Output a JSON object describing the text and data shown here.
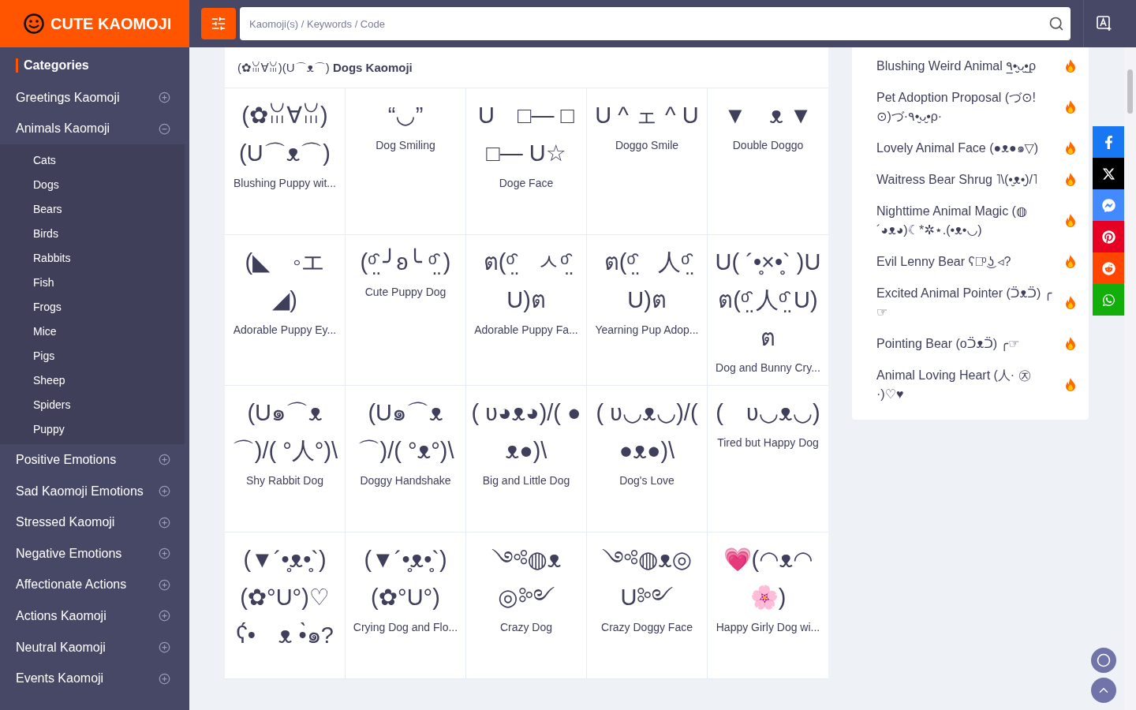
{
  "header": {
    "logo": "CUTE KAOMOJI",
    "search_placeholder": "Kaomoji(s) / Keywords / Code"
  },
  "sidebar": {
    "title": "Categories",
    "categories": [
      {
        "label": "Greetings Kaomoji",
        "expanded": false
      },
      {
        "label": "Animals Kaomoji",
        "expanded": true,
        "children": [
          {
            "label": "Cats"
          },
          {
            "label": "Dogs"
          },
          {
            "label": "Bears"
          },
          {
            "label": "Birds"
          },
          {
            "label": "Rabbits"
          },
          {
            "label": "Fish"
          },
          {
            "label": "Frogs"
          },
          {
            "label": "Mice"
          },
          {
            "label": "Pigs"
          },
          {
            "label": "Sheep"
          },
          {
            "label": "Spiders"
          },
          {
            "label": "Puppy"
          }
        ]
      },
      {
        "label": "Positive Emotions",
        "expanded": false
      },
      {
        "label": "Sad Kaomoji Emotions",
        "expanded": false
      },
      {
        "label": "Stressed Kaomoji",
        "expanded": false
      },
      {
        "label": "Negative Emotions",
        "expanded": false
      },
      {
        "label": "Affectionate Actions",
        "expanded": false
      },
      {
        "label": "Actions Kaomoji",
        "expanded": false
      },
      {
        "label": "Neutral Kaomoji",
        "expanded": false
      },
      {
        "label": "Events Kaomoji",
        "expanded": false
      }
    ]
  },
  "section": {
    "title": "(✿ꈍ∀ꈍ)(U⌒ᴥ⌒) **Dogs Kaomoji**"
  },
  "kaomoji": [
    {
      "kaomoji": "(✿ꈍ∀ꈍ)(U⌒ᴥ⌒)",
      "name": "Blushing Puppy wit..."
    },
    {
      "kaomoji": "“◡”",
      "name": "Dog Smiling"
    },
    {
      "kaomoji": "U　□— □　□— U☆",
      "name": "Doge Face"
    },
    {
      "kaomoji": "U ^ ェ ^ U",
      "name": "Doggo Smile"
    },
    {
      "kaomoji": "▼　ᴥ ▼",
      "name": "Double Doggo"
    },
    {
      "kaomoji": "(◣　◦エ ◢)",
      "name": "Adorable Puppy Ey..."
    },
    {
      "kaomoji": "(ᵒ̤̑ ╯ʚ╰ ᵒ̤̑ )",
      "name": "Cute Puppy Dog"
    },
    {
      "kaomoji": "ต(ᵒ̤̑　ㅅᵒ̤̑ U)ต",
      "name": "Adorable Puppy Fa..."
    },
    {
      "kaomoji": "ต(ᵒ̤̑　人ᵒ̤̑ U)ต",
      "name": "Yearning Pup Adop..."
    },
    {
      "kaomoji": "U( ´•̥×•̥` )Uต(ᵒ̤̑ 人ᵒ̤̑ U)ต",
      "name": "Dog and Bunny Cry..."
    },
    {
      "kaomoji": "(U๑⌒ᴥ⌒)/( °人°)\\",
      "name": "Shy Rabbit Dog"
    },
    {
      "kaomoji": "(U๑⌒ᴥ⌒)/( °ᴥ°)\\",
      "name": "Doggy Handshake"
    },
    {
      "kaomoji": "( ʋ◕ᴥ◕)/( ●ᴥ●)\\",
      "name": "Big and Little Dog"
    },
    {
      "kaomoji": "( ʋ◡ᴥ◡)/( ●ᴥ●)\\",
      "name": "Dog's Love"
    },
    {
      "kaomoji": "(　ʋ◡ᴥ◡)",
      "name": "Tired but Happy Dog"
    },
    {
      "kaomoji": "(▼´•̥ᴥ•̥`)(✿°U°)♡ ʕ́•　ᴥ •̀๑?"
    },
    {
      "kaomoji": "(▼´•̥ᴥ•̥`)(✿°U°)",
      "name": "Crying Dog and Flo..."
    },
    {
      "kaomoji": "༺◍ᴥ◎༻",
      "name": "Crazy Dog"
    },
    {
      "kaomoji": "༺◍ᴥ◎U༻",
      "name": "Crazy Doggy Face"
    },
    {
      "kaomoji": "💗(◠ᴥ◠ 🌸)",
      "name": "Happy Girly Dog wi..."
    }
  ],
  "trending": [
    {
      "text": "Blushing Weird Animal ٩̲•ּ̮̮ᴗ̮•̲ρ"
    },
    {
      "text": "Pet Adoption Proposal (づ⊙! ⊙)づ·٩•̮ᴗ̮•ρ·"
    },
    {
      "text": "Lovely Animal Face (●ᴥ●๑▽)"
    },
    {
      "text": "Waitress Bear Shrug ˥\\(•̮ᴥ•̮)/˥"
    },
    {
      "text": "Nighttime Animal Magic (◍ ´◕ᴥ◕)☾*✲⋆.(•ᴥ•◡)"
    },
    {
      "text": "Evil Lenny Bear ʕ▹ͦ ͜ʖ ◃?"
    },
    {
      "text": "Excited Animal Pointer (ᑒᴥᑒ) ╭☞"
    },
    {
      "text": "Pointing Bear (oᑒᴥᑒ) ╭☞"
    },
    {
      "text": "Animal Loving Heart (人· ㉨·)♡♥"
    }
  ],
  "share": [
    {
      "kind": "facebook",
      "color": "#1877f2"
    },
    {
      "kind": "x",
      "color": "#000000"
    },
    {
      "kind": "messenger",
      "color": "#448aff"
    },
    {
      "kind": "pinterest",
      "color": "#e60023"
    },
    {
      "kind": "reddit",
      "color": "#ff4500"
    },
    {
      "kind": "whatsapp",
      "color": "#12af0a"
    }
  ]
}
